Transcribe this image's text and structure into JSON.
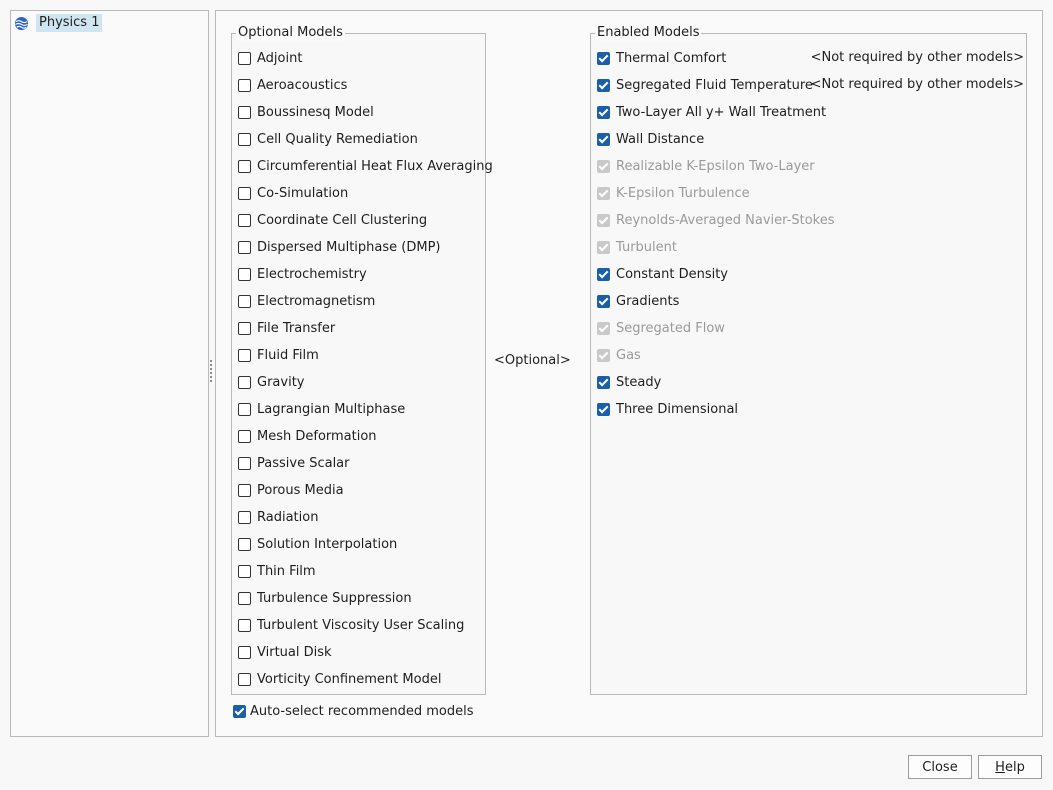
{
  "tree": {
    "node_label": "Physics 1"
  },
  "optional_models": {
    "title": "Optional Models",
    "items": [
      "Adjoint",
      "Aeroacoustics",
      "Boussinesq Model",
      "Cell Quality Remediation",
      "Circumferential Heat Flux Averaging",
      "Co-Simulation",
      "Coordinate Cell Clustering",
      "Dispersed Multiphase (DMP)",
      "Electrochemistry",
      "Electromagnetism",
      "File Transfer",
      "Fluid Film",
      "Gravity",
      "Lagrangian Multiphase",
      "Mesh Deformation",
      "Passive Scalar",
      "Porous Media",
      "Radiation",
      "Solution Interpolation",
      "Thin Film",
      "Turbulence Suppression",
      "Turbulent Viscosity User Scaling",
      "Virtual Disk",
      "Vorticity Confinement Model"
    ]
  },
  "middle": {
    "optional_label": "<Optional>"
  },
  "enabled_models": {
    "title": "Enabled Models",
    "items": [
      {
        "label": "Thermal Comfort",
        "state": "checked",
        "note": "<Not required by other models>"
      },
      {
        "label": "Segregated Fluid Temperature",
        "state": "checked",
        "note": "<Not required by other models>"
      },
      {
        "label": "Two-Layer All y+ Wall Treatment",
        "state": "checked"
      },
      {
        "label": "Wall Distance",
        "state": "checked"
      },
      {
        "label": "Realizable K-Epsilon Two-Layer",
        "state": "disabled"
      },
      {
        "label": "K-Epsilon Turbulence",
        "state": "disabled"
      },
      {
        "label": "Reynolds-Averaged Navier-Stokes",
        "state": "disabled"
      },
      {
        "label": "Turbulent",
        "state": "disabled"
      },
      {
        "label": "Constant Density",
        "state": "checked"
      },
      {
        "label": "Gradients",
        "state": "checked"
      },
      {
        "label": "Segregated Flow",
        "state": "disabled"
      },
      {
        "label": "Gas",
        "state": "disabled"
      },
      {
        "label": "Steady",
        "state": "checked"
      },
      {
        "label": "Three Dimensional",
        "state": "checked"
      }
    ]
  },
  "auto_select": {
    "label": "Auto-select recommended models",
    "checked": true
  },
  "buttons": {
    "close": "Close",
    "help_prefix": "H",
    "help_rest": "elp"
  },
  "colors": {
    "accent": "#1b5faa",
    "disabled": "#c9c9c9",
    "selection": "#cfe6f0"
  }
}
